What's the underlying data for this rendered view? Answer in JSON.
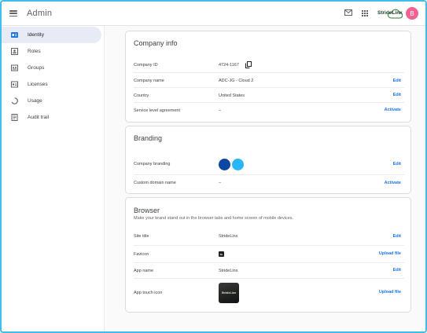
{
  "topbar": {
    "title": "Admin",
    "brand_text": "StrideLinx",
    "avatar_letter": "B"
  },
  "sidebar": {
    "items": [
      {
        "label": "Identity",
        "icon": "id-card-icon",
        "active": true
      },
      {
        "label": "Roles",
        "icon": "roles-icon",
        "active": false
      },
      {
        "label": "Groups",
        "icon": "groups-icon",
        "active": false
      },
      {
        "label": "Licenses",
        "icon": "licenses-icon",
        "active": false
      },
      {
        "label": "Usage",
        "icon": "usage-icon",
        "active": false
      },
      {
        "label": "Audit trail",
        "icon": "audit-trail-icon",
        "active": false
      }
    ]
  },
  "company_info": {
    "title": "Company info",
    "rows": [
      {
        "label": "Company ID",
        "value": "4724-1167",
        "action": ""
      },
      {
        "label": "Company name",
        "value": "ADC-JG - Cloud 2",
        "action": "Edit"
      },
      {
        "label": "Country",
        "value": "United States",
        "action": "Edit"
      },
      {
        "label": "Service level agreement",
        "value": "–",
        "action": "Activate"
      }
    ]
  },
  "branding": {
    "title": "Branding",
    "rows": [
      {
        "label": "Company branding",
        "value": "",
        "action": "Edit"
      },
      {
        "label": "Custom domain name",
        "value": "–",
        "action": "Activate"
      }
    ],
    "colors": [
      "#0d47a1",
      "#29b6f6"
    ]
  },
  "browser": {
    "title": "Browser",
    "subtitle": "Make your brand stand out in the browser tabs and home screen of mobile devices.",
    "rows": [
      {
        "label": "Site title",
        "value": "StrideLinx",
        "action": "Edit"
      },
      {
        "label": "Favicon",
        "value": "",
        "action": "Upload file"
      },
      {
        "label": "App name",
        "value": "StrideLinx",
        "action": "Edit"
      },
      {
        "label": "App touch icon",
        "value": "",
        "action": "Upload file"
      }
    ],
    "touch_icon_text": "StrideLinx"
  },
  "colors": {
    "accent": "#1a73e8",
    "active_nav": "#e8eaf6",
    "frame": "#3dbfe8",
    "avatar": "#f06292"
  }
}
